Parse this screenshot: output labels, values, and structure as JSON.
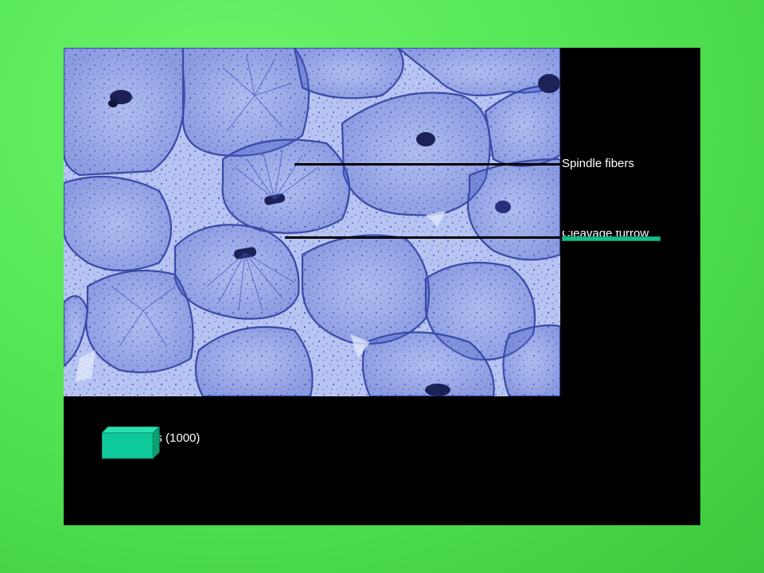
{
  "slide": {
    "labels": {
      "spindle": "Spindle fibers",
      "furrow": "Cleavage furrow"
    },
    "caption": "e of Mitosis (1000)"
  },
  "colors": {
    "background": "#55e655",
    "panel": "#000000",
    "cell_stain": "#3f55c7",
    "box": "#10c99a",
    "text": "#ffffff"
  },
  "icons": {
    "cube": "cube-icon"
  }
}
